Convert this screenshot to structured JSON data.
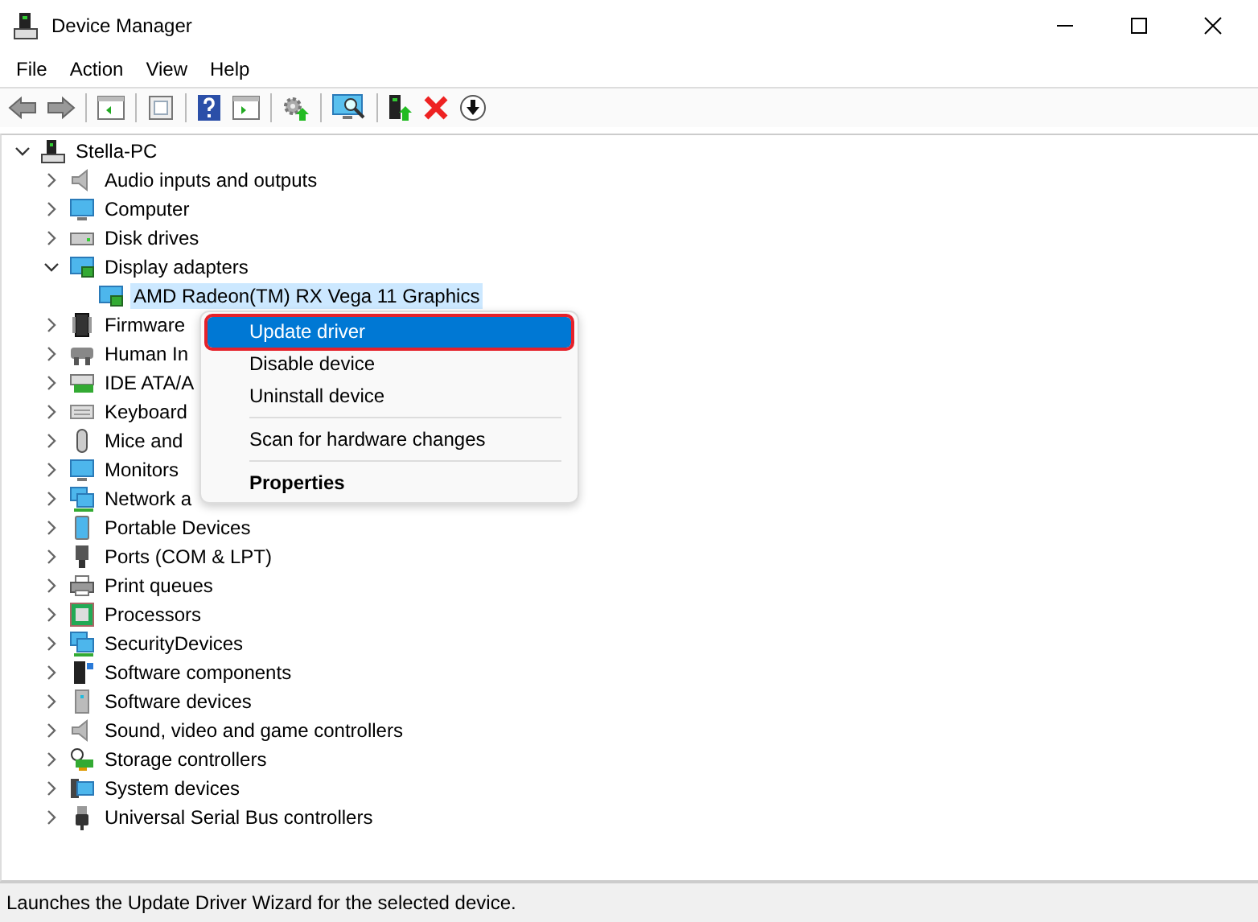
{
  "window": {
    "title": "Device Manager"
  },
  "menu_bar": [
    "File",
    "Action",
    "View",
    "Help"
  ],
  "tree": {
    "label": "Stella-PC",
    "expanded": true,
    "selected": false,
    "children": [
      {
        "label": "Audio inputs and outputs",
        "expanded": false,
        "selected": false
      },
      {
        "label": "Computer",
        "expanded": false,
        "selected": false
      },
      {
        "label": "Disk drives",
        "expanded": false,
        "selected": false
      },
      {
        "label": "Display adapters",
        "expanded": true,
        "selected": false,
        "children": [
          {
            "label": "AMD Radeon(TM) RX Vega 11 Graphics",
            "selected": true
          }
        ]
      },
      {
        "label": "Firmware",
        "expanded": false,
        "selected": false
      },
      {
        "label": "Human In",
        "expanded": false,
        "selected": false
      },
      {
        "label": "IDE ATA/A",
        "expanded": false,
        "selected": false
      },
      {
        "label": "Keyboard",
        "expanded": false,
        "selected": false
      },
      {
        "label": "Mice and",
        "expanded": false,
        "selected": false
      },
      {
        "label": "Monitors",
        "expanded": false,
        "selected": false
      },
      {
        "label": "Network a",
        "expanded": false,
        "selected": false
      },
      {
        "label": "Portable Devices",
        "expanded": false,
        "selected": false
      },
      {
        "label": "Ports (COM & LPT)",
        "expanded": false,
        "selected": false
      },
      {
        "label": "Print queues",
        "expanded": false,
        "selected": false
      },
      {
        "label": "Processors",
        "expanded": false,
        "selected": false
      },
      {
        "label": "SecurityDevices",
        "expanded": false,
        "selected": false
      },
      {
        "label": "Software components",
        "expanded": false,
        "selected": false
      },
      {
        "label": "Software devices",
        "expanded": false,
        "selected": false
      },
      {
        "label": "Sound, video and game controllers",
        "expanded": false,
        "selected": false
      },
      {
        "label": "Storage controllers",
        "expanded": false,
        "selected": false
      },
      {
        "label": "System devices",
        "expanded": false,
        "selected": false
      },
      {
        "label": "Universal Serial Bus controllers",
        "expanded": false,
        "selected": false
      }
    ]
  },
  "context_menu": [
    {
      "kind": "item",
      "label": "Update driver",
      "selected": true
    },
    {
      "kind": "item",
      "label": "Disable device",
      "selected": false
    },
    {
      "kind": "item",
      "label": "Uninstall device",
      "selected": false
    },
    {
      "kind": "separator"
    },
    {
      "kind": "item",
      "label": "Scan for hardware changes",
      "selected": false
    },
    {
      "kind": "separator"
    },
    {
      "kind": "default",
      "label": "Properties",
      "selected": false
    }
  ],
  "status_bar": "Launches the Update Driver Wizard for the selected device."
}
